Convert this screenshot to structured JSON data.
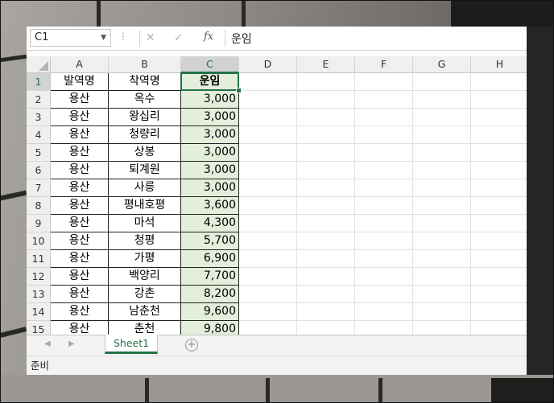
{
  "name_box": {
    "value": "C1",
    "dropdown_icon": "triangle-down"
  },
  "formula_bar": {
    "cancel_icon": "x",
    "enter_icon": "check",
    "fx_label": "fx",
    "value": "운임"
  },
  "columns": [
    "A",
    "B",
    "C",
    "D",
    "E",
    "F",
    "G",
    "H"
  ],
  "selected_column": "C",
  "selected_row": 1,
  "headers": {
    "a": "발역명",
    "b": "착역명",
    "c": "운임"
  },
  "rows": [
    {
      "num": "2",
      "a": "용산",
      "b": "옥수",
      "c": "3,000"
    },
    {
      "num": "3",
      "a": "용산",
      "b": "왕십리",
      "c": "3,000"
    },
    {
      "num": "4",
      "a": "용산",
      "b": "청량리",
      "c": "3,000"
    },
    {
      "num": "5",
      "a": "용산",
      "b": "상봉",
      "c": "3,000"
    },
    {
      "num": "6",
      "a": "용산",
      "b": "퇴계원",
      "c": "3,000"
    },
    {
      "num": "7",
      "a": "용산",
      "b": "사릉",
      "c": "3,000"
    },
    {
      "num": "8",
      "a": "용산",
      "b": "평내호평",
      "c": "3,600"
    },
    {
      "num": "9",
      "a": "용산",
      "b": "마석",
      "c": "4,300"
    },
    {
      "num": "10",
      "a": "용산",
      "b": "청평",
      "c": "5,700"
    },
    {
      "num": "11",
      "a": "용산",
      "b": "가평",
      "c": "6,900"
    },
    {
      "num": "12",
      "a": "용산",
      "b": "백양리",
      "c": "7,700"
    },
    {
      "num": "13",
      "a": "용산",
      "b": "강촌",
      "c": "8,200"
    },
    {
      "num": "14",
      "a": "용산",
      "b": "남춘천",
      "c": "9,600"
    },
    {
      "num": "15",
      "a": "용산",
      "b": "춘천",
      "c": "9,800"
    }
  ],
  "sheet_tabs": [
    {
      "label": "Sheet1",
      "active": true
    }
  ],
  "status_text": "준비",
  "colors": {
    "accent": "#217346",
    "highlight_fill": "#e3eedb"
  }
}
